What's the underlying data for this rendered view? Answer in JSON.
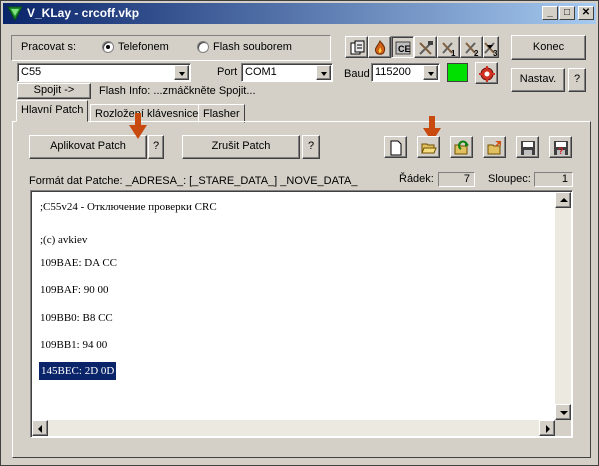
{
  "window": {
    "title": "V_KLay - crcoff.vkp"
  },
  "title_buttons": {
    "minimize": "_",
    "maximize": "□",
    "close": "✕"
  },
  "connection": {
    "mode_label": "Pracovat s:",
    "phone_option": "Telefonem",
    "file_option": "Flash souborem",
    "model_value": "C55",
    "port_label": "Port",
    "port_value": "COM1",
    "baud_label": "Baud",
    "baud_value": "115200",
    "connect_button": "Spojit ->",
    "flash_info": "Flash Info: ...zmáčkněte Spojit...",
    "status_color": "#00e000"
  },
  "right_buttons": {
    "exit": "Konec",
    "settings": "Nastav.",
    "help": "?"
  },
  "toolbar_icons": {
    "tool1_badge": "1",
    "tool2_badge": "2",
    "tool3_badge": "3"
  },
  "tabs": [
    {
      "label": "Hlavní Patch"
    },
    {
      "label": "Rozložení klávesnice"
    },
    {
      "label": "Flasher"
    }
  ],
  "patch": {
    "apply_button": "Aplikovat Patch",
    "apply_help": "?",
    "cancel_button": "Zrušit Patch",
    "cancel_help": "?",
    "format_text": "Formát dat Patche: _ADRESA_: [_STARE_DATA_] _NOVE_DATA_",
    "row_label": "Řádek:",
    "row_value": "7",
    "col_label": "Sloupec:",
    "col_value": "1"
  },
  "editor_lines": [
    ";C55v24 - Отключение проверки CRC",
    ";(c) avkiev",
    "109BAE: DA CC",
    "109BAF: 90 00",
    "109BB0: B8 CC",
    "109BB1: 94 00",
    "145BEC: 2D 0D"
  ],
  "colors": {
    "title_start": "#0a246a",
    "title_end": "#a6caf0",
    "selection": "#0a246a",
    "annotation_arrow": "#c84a0e"
  }
}
